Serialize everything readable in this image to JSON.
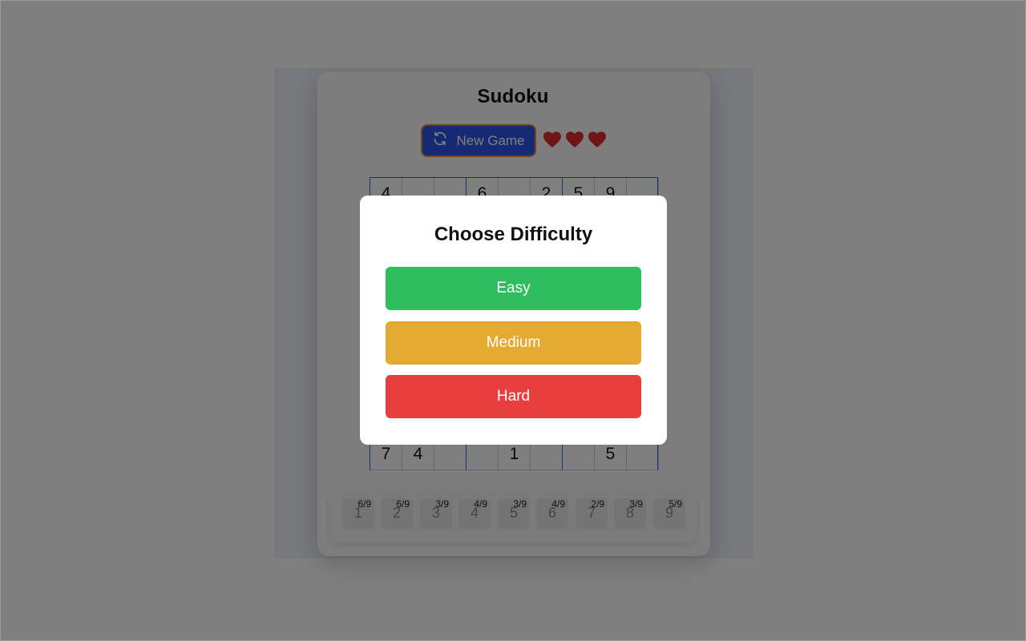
{
  "app": {
    "title": "Sudoku"
  },
  "toolbar": {
    "new_game_label": "New Game",
    "new_game_icon": "refresh-icon",
    "lives": 3,
    "life_icon": "heart-icon"
  },
  "board": {
    "rows": [
      [
        "4",
        "",
        "",
        "6",
        "",
        "2",
        "5",
        "9",
        ""
      ],
      [
        "",
        "",
        "",
        "",
        "",
        "",
        "",
        "",
        ""
      ],
      [
        "",
        "",
        "",
        "",
        "",
        "",
        "",
        "",
        ""
      ],
      [
        "",
        "",
        "",
        "",
        "",
        "",
        "",
        "",
        ""
      ],
      [
        "",
        "",
        "",
        "",
        "",
        "",
        "",
        "",
        ""
      ],
      [
        "",
        "",
        "",
        "",
        "",
        "",
        "",
        "",
        ""
      ],
      [
        "",
        "",
        "",
        "",
        "",
        "",
        "",
        "",
        ""
      ],
      [
        "",
        "",
        "",
        "",
        "",
        "",
        "",
        "",
        ""
      ],
      [
        "7",
        "4",
        "",
        "",
        "1",
        "",
        "",
        "5",
        ""
      ]
    ]
  },
  "numpad": [
    {
      "digit": "1",
      "count": "6/9"
    },
    {
      "digit": "2",
      "count": "6/9"
    },
    {
      "digit": "3",
      "count": "3/9"
    },
    {
      "digit": "4",
      "count": "4/9"
    },
    {
      "digit": "5",
      "count": "3/9"
    },
    {
      "digit": "6",
      "count": "4/9"
    },
    {
      "digit": "7",
      "count": "2/9"
    },
    {
      "digit": "8",
      "count": "3/9"
    },
    {
      "digit": "9",
      "count": "5/9"
    }
  ],
  "modal": {
    "title": "Choose Difficulty",
    "options": [
      {
        "label": "Easy",
        "color": "#2ebd5f"
      },
      {
        "label": "Medium",
        "color": "#e4aa31"
      },
      {
        "label": "Hard",
        "color": "#e93e3e"
      }
    ]
  },
  "colors": {
    "accent": "#2a55e6",
    "heart": "#e02d2d",
    "grid_border": "#3a5bd9"
  }
}
